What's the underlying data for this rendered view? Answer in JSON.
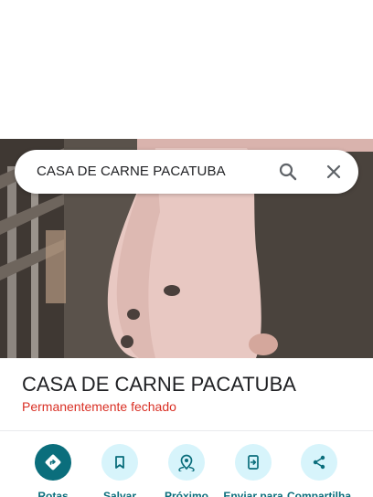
{
  "search": {
    "query": "CASA DE CARNE PACATUBA"
  },
  "place": {
    "title": "CASA DE CARNE PACATUBA",
    "status": "Permanentemente fechado",
    "status_color": "#d93025"
  },
  "actions": [
    {
      "label": "Rotas",
      "icon": "directions-icon"
    },
    {
      "label": "Salvar",
      "icon": "bookmark-icon"
    },
    {
      "label": "Próximo",
      "icon": "nearby-icon"
    },
    {
      "label": "Enviar para",
      "icon": "send-to-phone-icon"
    },
    {
      "label": "Compartilha",
      "icon": "share-icon"
    }
  ],
  "colors": {
    "accent": "#0b6e7c",
    "accent_light": "#d7f4fb"
  }
}
